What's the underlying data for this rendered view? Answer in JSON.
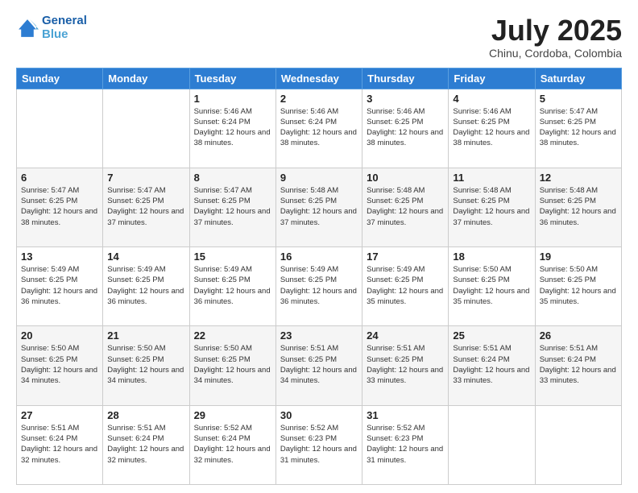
{
  "header": {
    "logo_line1": "General",
    "logo_line2": "Blue",
    "month": "July 2025",
    "location": "Chinu, Cordoba, Colombia"
  },
  "days_of_week": [
    "Sunday",
    "Monday",
    "Tuesday",
    "Wednesday",
    "Thursday",
    "Friday",
    "Saturday"
  ],
  "weeks": [
    [
      {
        "day": "",
        "info": ""
      },
      {
        "day": "",
        "info": ""
      },
      {
        "day": "1",
        "info": "Sunrise: 5:46 AM\nSunset: 6:24 PM\nDaylight: 12 hours\nand 38 minutes."
      },
      {
        "day": "2",
        "info": "Sunrise: 5:46 AM\nSunset: 6:24 PM\nDaylight: 12 hours\nand 38 minutes."
      },
      {
        "day": "3",
        "info": "Sunrise: 5:46 AM\nSunset: 6:25 PM\nDaylight: 12 hours\nand 38 minutes."
      },
      {
        "day": "4",
        "info": "Sunrise: 5:46 AM\nSunset: 6:25 PM\nDaylight: 12 hours\nand 38 minutes."
      },
      {
        "day": "5",
        "info": "Sunrise: 5:47 AM\nSunset: 6:25 PM\nDaylight: 12 hours\nand 38 minutes."
      }
    ],
    [
      {
        "day": "6",
        "info": "Sunrise: 5:47 AM\nSunset: 6:25 PM\nDaylight: 12 hours\nand 38 minutes."
      },
      {
        "day": "7",
        "info": "Sunrise: 5:47 AM\nSunset: 6:25 PM\nDaylight: 12 hours\nand 37 minutes."
      },
      {
        "day": "8",
        "info": "Sunrise: 5:47 AM\nSunset: 6:25 PM\nDaylight: 12 hours\nand 37 minutes."
      },
      {
        "day": "9",
        "info": "Sunrise: 5:48 AM\nSunset: 6:25 PM\nDaylight: 12 hours\nand 37 minutes."
      },
      {
        "day": "10",
        "info": "Sunrise: 5:48 AM\nSunset: 6:25 PM\nDaylight: 12 hours\nand 37 minutes."
      },
      {
        "day": "11",
        "info": "Sunrise: 5:48 AM\nSunset: 6:25 PM\nDaylight: 12 hours\nand 37 minutes."
      },
      {
        "day": "12",
        "info": "Sunrise: 5:48 AM\nSunset: 6:25 PM\nDaylight: 12 hours\nand 36 minutes."
      }
    ],
    [
      {
        "day": "13",
        "info": "Sunrise: 5:49 AM\nSunset: 6:25 PM\nDaylight: 12 hours\nand 36 minutes."
      },
      {
        "day": "14",
        "info": "Sunrise: 5:49 AM\nSunset: 6:25 PM\nDaylight: 12 hours\nand 36 minutes."
      },
      {
        "day": "15",
        "info": "Sunrise: 5:49 AM\nSunset: 6:25 PM\nDaylight: 12 hours\nand 36 minutes."
      },
      {
        "day": "16",
        "info": "Sunrise: 5:49 AM\nSunset: 6:25 PM\nDaylight: 12 hours\nand 36 minutes."
      },
      {
        "day": "17",
        "info": "Sunrise: 5:49 AM\nSunset: 6:25 PM\nDaylight: 12 hours\nand 35 minutes."
      },
      {
        "day": "18",
        "info": "Sunrise: 5:50 AM\nSunset: 6:25 PM\nDaylight: 12 hours\nand 35 minutes."
      },
      {
        "day": "19",
        "info": "Sunrise: 5:50 AM\nSunset: 6:25 PM\nDaylight: 12 hours\nand 35 minutes."
      }
    ],
    [
      {
        "day": "20",
        "info": "Sunrise: 5:50 AM\nSunset: 6:25 PM\nDaylight: 12 hours\nand 34 minutes."
      },
      {
        "day": "21",
        "info": "Sunrise: 5:50 AM\nSunset: 6:25 PM\nDaylight: 12 hours\nand 34 minutes."
      },
      {
        "day": "22",
        "info": "Sunrise: 5:50 AM\nSunset: 6:25 PM\nDaylight: 12 hours\nand 34 minutes."
      },
      {
        "day": "23",
        "info": "Sunrise: 5:51 AM\nSunset: 6:25 PM\nDaylight: 12 hours\nand 34 minutes."
      },
      {
        "day": "24",
        "info": "Sunrise: 5:51 AM\nSunset: 6:25 PM\nDaylight: 12 hours\nand 33 minutes."
      },
      {
        "day": "25",
        "info": "Sunrise: 5:51 AM\nSunset: 6:24 PM\nDaylight: 12 hours\nand 33 minutes."
      },
      {
        "day": "26",
        "info": "Sunrise: 5:51 AM\nSunset: 6:24 PM\nDaylight: 12 hours\nand 33 minutes."
      }
    ],
    [
      {
        "day": "27",
        "info": "Sunrise: 5:51 AM\nSunset: 6:24 PM\nDaylight: 12 hours\nand 32 minutes."
      },
      {
        "day": "28",
        "info": "Sunrise: 5:51 AM\nSunset: 6:24 PM\nDaylight: 12 hours\nand 32 minutes."
      },
      {
        "day": "29",
        "info": "Sunrise: 5:52 AM\nSunset: 6:24 PM\nDaylight: 12 hours\nand 32 minutes."
      },
      {
        "day": "30",
        "info": "Sunrise: 5:52 AM\nSunset: 6:23 PM\nDaylight: 12 hours\nand 31 minutes."
      },
      {
        "day": "31",
        "info": "Sunrise: 5:52 AM\nSunset: 6:23 PM\nDaylight: 12 hours\nand 31 minutes."
      },
      {
        "day": "",
        "info": ""
      },
      {
        "day": "",
        "info": ""
      }
    ]
  ]
}
